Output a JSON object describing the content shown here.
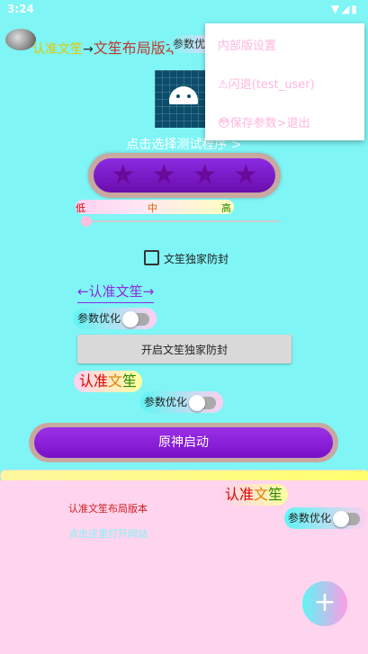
{
  "status_bar": {
    "time": "3:24",
    "icons": "▼◢▮"
  },
  "title_row": {
    "title_part1": "认准文笙",
    "title_part2": "→",
    "title_part3": "文笙布局版本",
    "param_label": "参数优化"
  },
  "menu": {
    "items": [
      "内部版设置",
      "⚠闪退(test_user)",
      "保存参数>退出"
    ],
    "item2_icon": "⚠",
    "item3_icon": "😳"
  },
  "main": {
    "pick_text": "点击选择测试程序 >",
    "lmh": {
      "low": "低",
      "mid": "中",
      "high": "高"
    },
    "checkbox_label": "文笙独家防封",
    "arrow_title": "←认准文笙→",
    "switch1_label": "参数优化",
    "gray_button": "开启文笙独家防封",
    "chip1": {
      "a": "认准",
      "b": "文",
      "c": "笙"
    },
    "switch2_label": "参数优化",
    "launch_button": "原神启动"
  },
  "panel": {
    "chip": {
      "a": "认准",
      "b": "文",
      "c": "笙"
    },
    "title": "认准文笙布局版本",
    "link": "点击这里打开网站",
    "switch_label": "参数优化",
    "fab": "+"
  },
  "colors": {
    "background": "#7ff5f5",
    "panel": "#ffd4ee",
    "purple": "#8a2be2"
  }
}
